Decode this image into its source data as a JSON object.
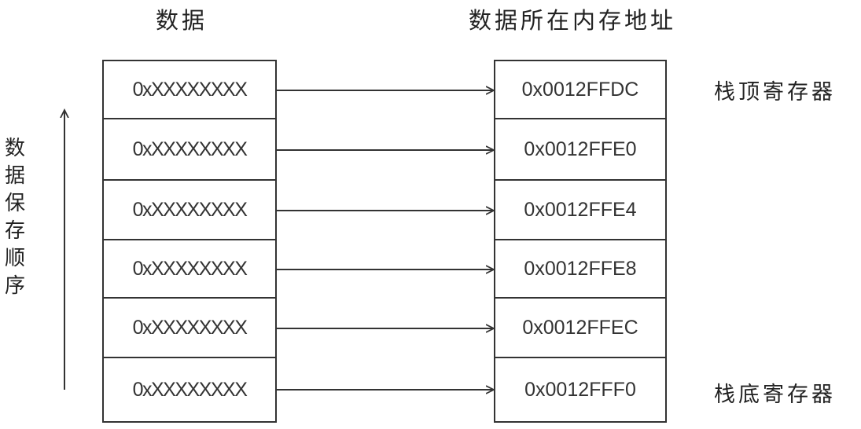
{
  "headers": {
    "data": "数据",
    "address": "数据所在内存地址"
  },
  "side_labels": {
    "order": "数据保存顺序",
    "stack_top": "栈顶寄存器",
    "stack_bottom": "栈底寄存器"
  },
  "rows": [
    {
      "data": "0xXXXXXXXX",
      "address": "0x0012FFDC"
    },
    {
      "data": "0xXXXXXXXX",
      "address": "0x0012FFE0"
    },
    {
      "data": "0xXXXXXXXX",
      "address": "0x0012FFE4"
    },
    {
      "data": "0xXXXXXXXX",
      "address": "0x0012FFE8"
    },
    {
      "data": "0xXXXXXXXX",
      "address": "0x0012FFEC"
    },
    {
      "data": "0xXXXXXXXX",
      "address": "0x0012FFF0"
    }
  ],
  "colors": {
    "line": "#333333",
    "text": "#222222",
    "background": "#ffffff"
  }
}
